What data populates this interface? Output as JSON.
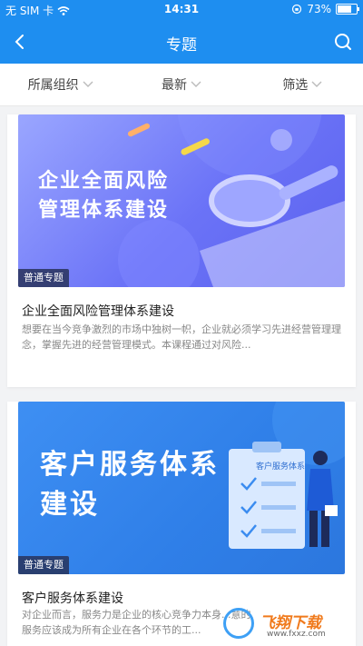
{
  "status_bar": {
    "carrier": "无 SIM 卡",
    "time": "14:31",
    "battery": "73%",
    "battery_level": 0.73
  },
  "nav": {
    "title": "专题"
  },
  "filters": [
    {
      "label": "所属组织"
    },
    {
      "label": "最新"
    },
    {
      "label": "筛选"
    }
  ],
  "cards": [
    {
      "banner_line1": "企业全面风险",
      "banner_line2": "管理体系建设",
      "tag": "普通专题",
      "title": "企业全面风险管理体系建设",
      "desc": "想要在当今竞争激烈的市场中独树一帜，企业就必须学习先进经营管理理念，掌握先进的经营管理模式。本课程通过对风险..."
    },
    {
      "banner_line1": "客户服务体系",
      "banner_line2": "建设",
      "banner_doc_label": "客户服务体系",
      "tag": "普通专题",
      "title": "客户服务体系建设",
      "desc": "对企业而言，服务力是企业的核心竞争力本身...意的服务应该成为所有企业在各个环节的工..."
    }
  ],
  "watermark": {
    "brand": "飞翔下载",
    "url": "www.fxxz.com"
  },
  "colors": {
    "primary": "#1e8ef0",
    "banner1": "#6b73f7",
    "banner2": "#2f7fe8",
    "watermark_orange": "#f07a1c"
  }
}
